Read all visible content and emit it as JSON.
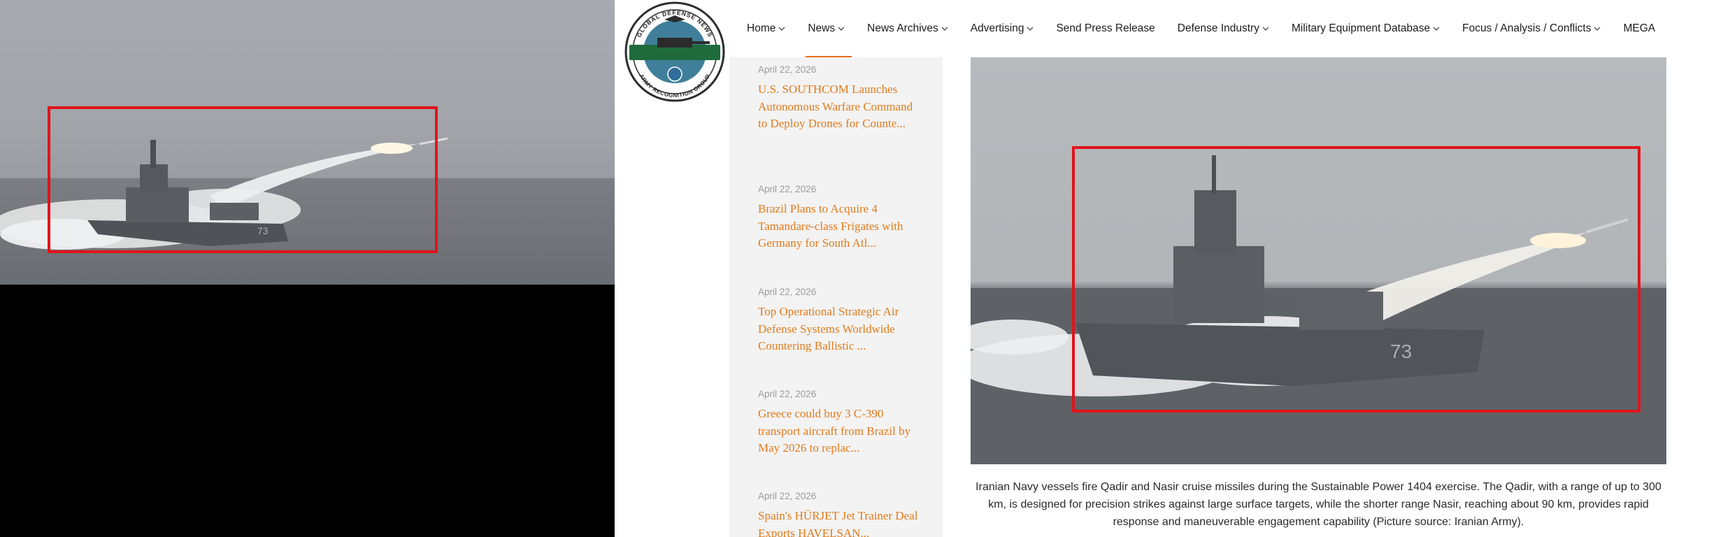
{
  "video": {
    "colors": {
      "box": "#e0141b"
    }
  },
  "site": {
    "logo": {
      "text_top": "GLOBAL DEFENSE NEWS",
      "text_bottom": "ARMY RECOGNITION GROUP"
    },
    "nav": [
      {
        "label": "Home",
        "chevron": true
      },
      {
        "label": "News",
        "chevron": true,
        "active": true
      },
      {
        "label": "News Archives",
        "chevron": true
      },
      {
        "label": "Advertising",
        "chevron": true
      },
      {
        "label": "Send Press Release",
        "chevron": false
      },
      {
        "label": "Defense Industry",
        "chevron": true
      },
      {
        "label": "Military Equipment Database",
        "chevron": true
      },
      {
        "label": "Focus / Analysis / Conflicts",
        "chevron": true
      },
      {
        "label": "MEGA",
        "chevron": false
      }
    ],
    "sidebar": {
      "items": [
        {
          "date": "April 22, 2026",
          "title": "U.S. SOUTHCOM Launches Autonomous Warfare Command to Deploy Drones for Counte..."
        },
        {
          "date": "April 22, 2026",
          "title": "Brazil Plans to Acquire 4 Tamandare-class Frigates with Germany for South Atl..."
        },
        {
          "date": "April 22, 2026",
          "title": "Top Operational Strategic Air Defense Systems Worldwide Countering Ballistic ..."
        },
        {
          "date": "April 22, 2026",
          "title": "Greece could buy 3 C-390 transport aircraft from Brazil by May 2026 to replac..."
        },
        {
          "date": "April 22, 2026",
          "title": "Spain's HÜRJET Jet Trainer Deal Exports HAVELSAN..."
        }
      ]
    },
    "article": {
      "hull_number": "73",
      "caption": "Iranian Navy vessels fire Qadir and Nasir cruise missiles during the Sustainable Power 1404 exercise. The Qadir, with a range of up to 300 km, is designed for precision strikes against large surface targets, while the shorter range Nasir, reaching about 90 km, provides rapid response and maneuverable engagement capability (Picture source: Iranian Army)."
    },
    "colors": {
      "accent": "#e46b1f",
      "link": "#e27a1b",
      "box": "#e0141b"
    }
  }
}
